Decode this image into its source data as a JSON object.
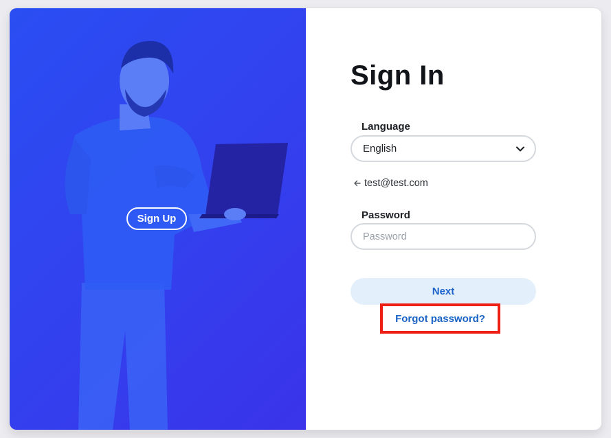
{
  "hero": {
    "signup_label": "Sign Up"
  },
  "form": {
    "title": "Sign In",
    "language_label": "Language",
    "language_value": "English",
    "email": "test@test.com",
    "password_label": "Password",
    "password_placeholder": "Password",
    "next_label": "Next",
    "forgot_label": "Forgot password?"
  },
  "colors": {
    "hero_blue": "#2f46f0",
    "next_bg": "#e3f0fc",
    "link_blue": "#1a63c4",
    "highlight_red": "#ee1f15"
  }
}
